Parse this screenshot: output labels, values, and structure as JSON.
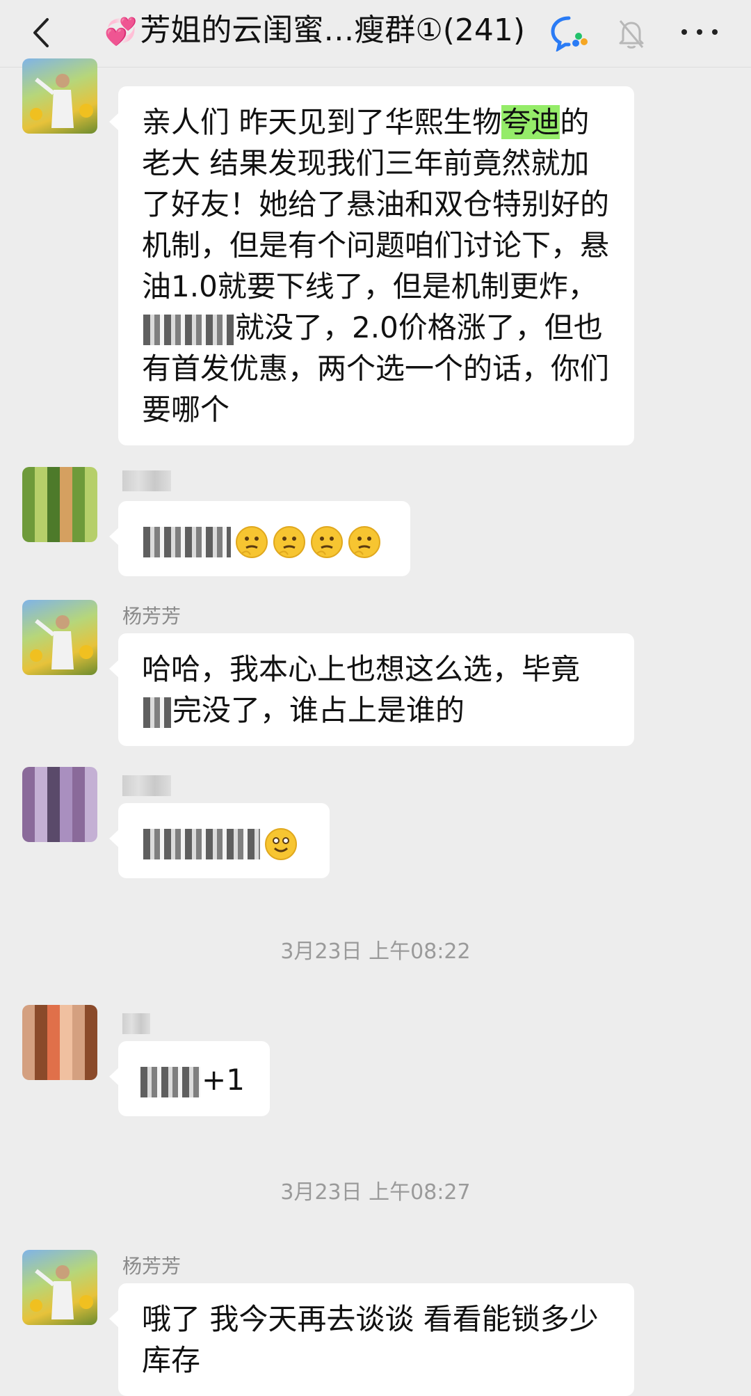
{
  "header": {
    "title": "芳姐的云闺蜜…瘦群①(241)",
    "heart_emoji": "💞",
    "icons": [
      "back-icon",
      "tencent-meeting-icon",
      "mute-bell-icon",
      "more-icon"
    ]
  },
  "messages": [
    {
      "sender": "",
      "text_before": "亲人们 昨天见到了华熙生物",
      "highlight": "夸迪",
      "text_after_1": "的老大 结果发现我们三年前竟然就加了好友！她给了悬油和双仓特别好的机制，但是有个问题咱们讨论下，悬油1.0就要下线了，但是机制更炸，",
      "text_after_2": "就没了，2.0价格涨了，但也有首发优惠，两个选一个的话，你们要哪个"
    },
    {
      "sender": "",
      "emoji_count": 4,
      "emoji_name": "thinking-emoji"
    },
    {
      "sender": "杨芳芳",
      "text_1": "哈哈，我本心上也想这么选，毕竟",
      "text_2": "完没了，谁占上是谁的"
    },
    {
      "sender": "",
      "emoji_name": "smile-emoji"
    },
    {
      "timestamp": "3月23日 上午08:22"
    },
    {
      "sender": "",
      "text": "+1"
    },
    {
      "timestamp": "3月23日 上午08:27"
    },
    {
      "sender": "杨芳芳",
      "text": "哦了 我今天再去谈谈 看看能锁多少库存"
    }
  ],
  "colors": {
    "background": "#ededed",
    "bubble": "#ffffff",
    "highlight": "#95ec69",
    "sender_name": "#8a8a8a",
    "timestamp": "#9a9a9a"
  }
}
